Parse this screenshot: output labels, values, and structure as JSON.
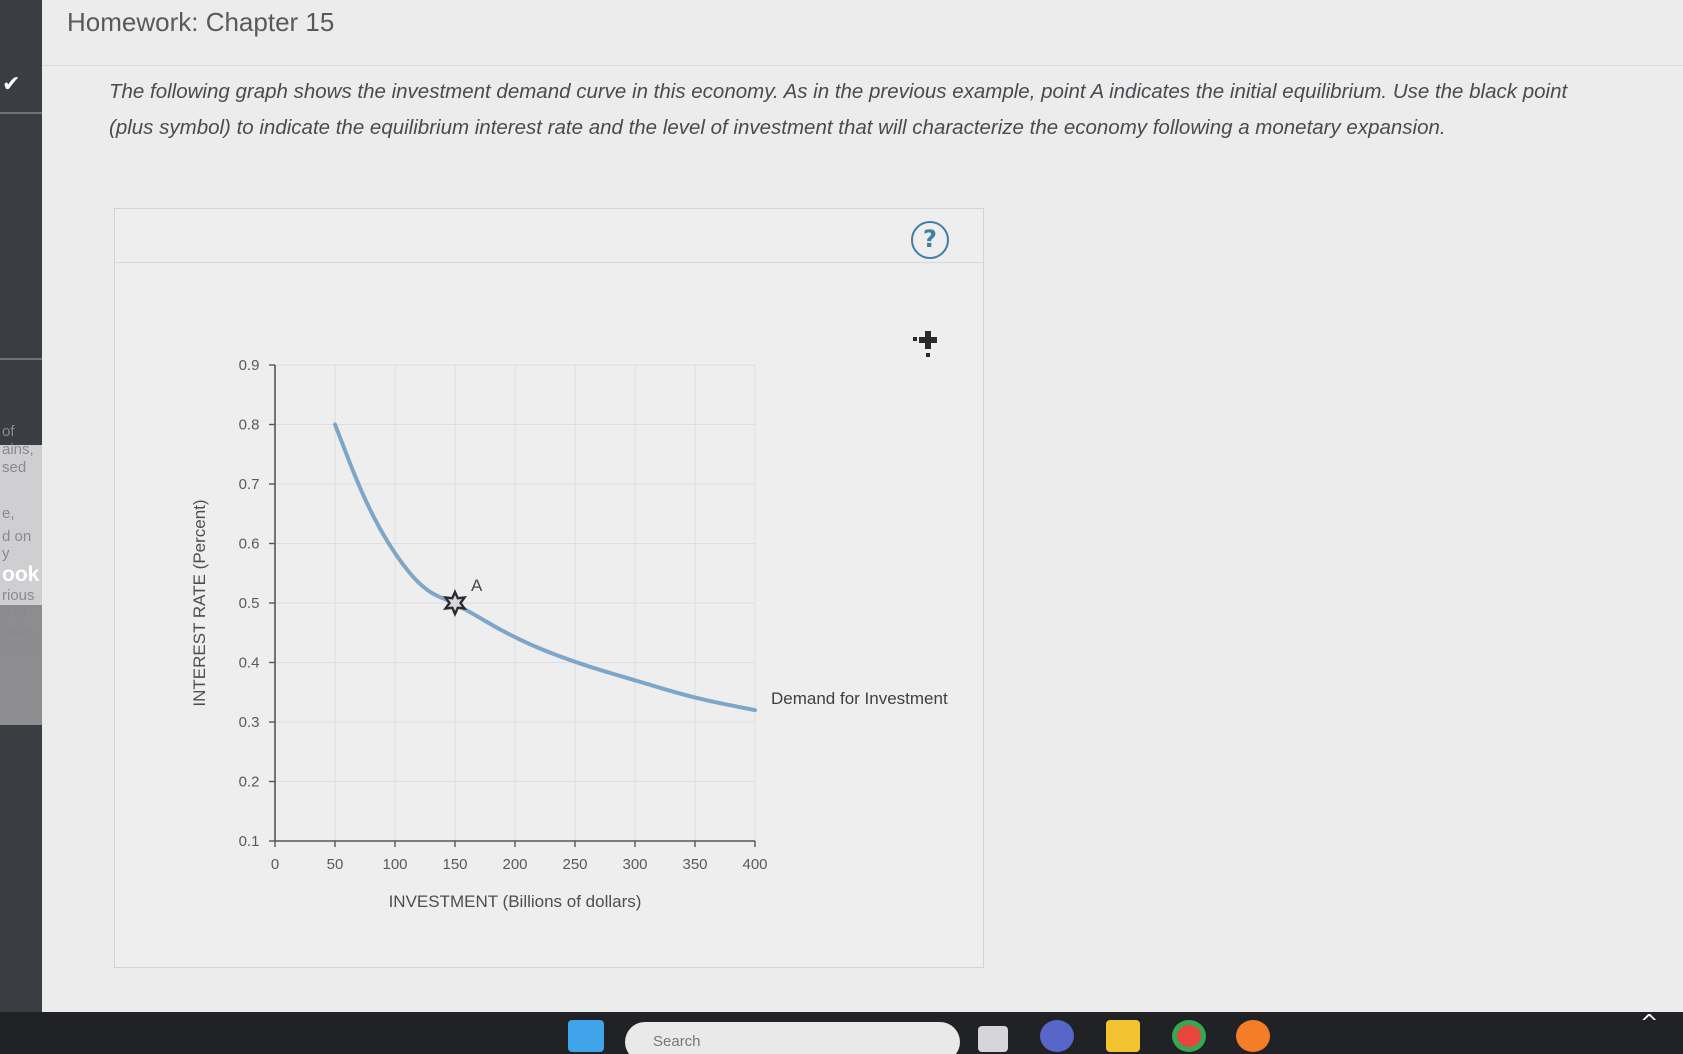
{
  "page": {
    "title": "Homework: Chapter 15",
    "instructions": "The following graph shows the investment demand curve in this economy. As in the previous example, point A indicates the initial equilibrium. Use the black point (plus symbol) to indicate the equilibrium interest rate and the level of investment that will characterize the economy following a monetary expansion."
  },
  "sidebar": {
    "fragments": [
      "of",
      "ains,",
      "sed",
      "e,",
      "d on",
      "y",
      "ook",
      "rious",
      "e of",
      "rains,",
      "ased"
    ]
  },
  "graph": {
    "help_label": "?",
    "tool_name": "black point (plus symbol)",
    "accent_color": "#7ea6c9",
    "help_color": "#3f7fa6"
  },
  "chart_data": {
    "type": "line",
    "xlabel": "INVESTMENT (Billions of dollars)",
    "ylabel": "INTEREST RATE (Percent)",
    "xlim": [
      0,
      400
    ],
    "ylim": [
      0.1,
      0.9
    ],
    "xticks": [
      0,
      50,
      100,
      150,
      200,
      250,
      300,
      350,
      400
    ],
    "yticks": [
      0.1,
      0.2,
      0.3,
      0.4,
      0.5,
      0.6,
      0.7,
      0.8,
      0.9
    ],
    "xtick_labels": [
      "0",
      "50",
      "100",
      "150",
      "200",
      "250",
      "300",
      "350",
      "400"
    ],
    "ytick_labels": [
      "0.1",
      "0.2",
      "0.3",
      "0.4",
      "0.5",
      "0.6",
      "0.7",
      "0.8",
      "0.9"
    ],
    "grid": true,
    "series": [
      {
        "name": "Demand for Investment",
        "color": "#7ea6c9",
        "x": [
          50,
          75,
          100,
          125,
          150,
          200,
          250,
          300,
          350,
          400
        ],
        "y": [
          0.8,
          0.67,
          0.58,
          0.52,
          0.5,
          0.44,
          0.4,
          0.37,
          0.34,
          0.32
        ]
      }
    ],
    "points": [
      {
        "label": "A",
        "x": 150,
        "y": 0.5
      }
    ]
  },
  "taskbar": {
    "search_placeholder": "Search"
  }
}
